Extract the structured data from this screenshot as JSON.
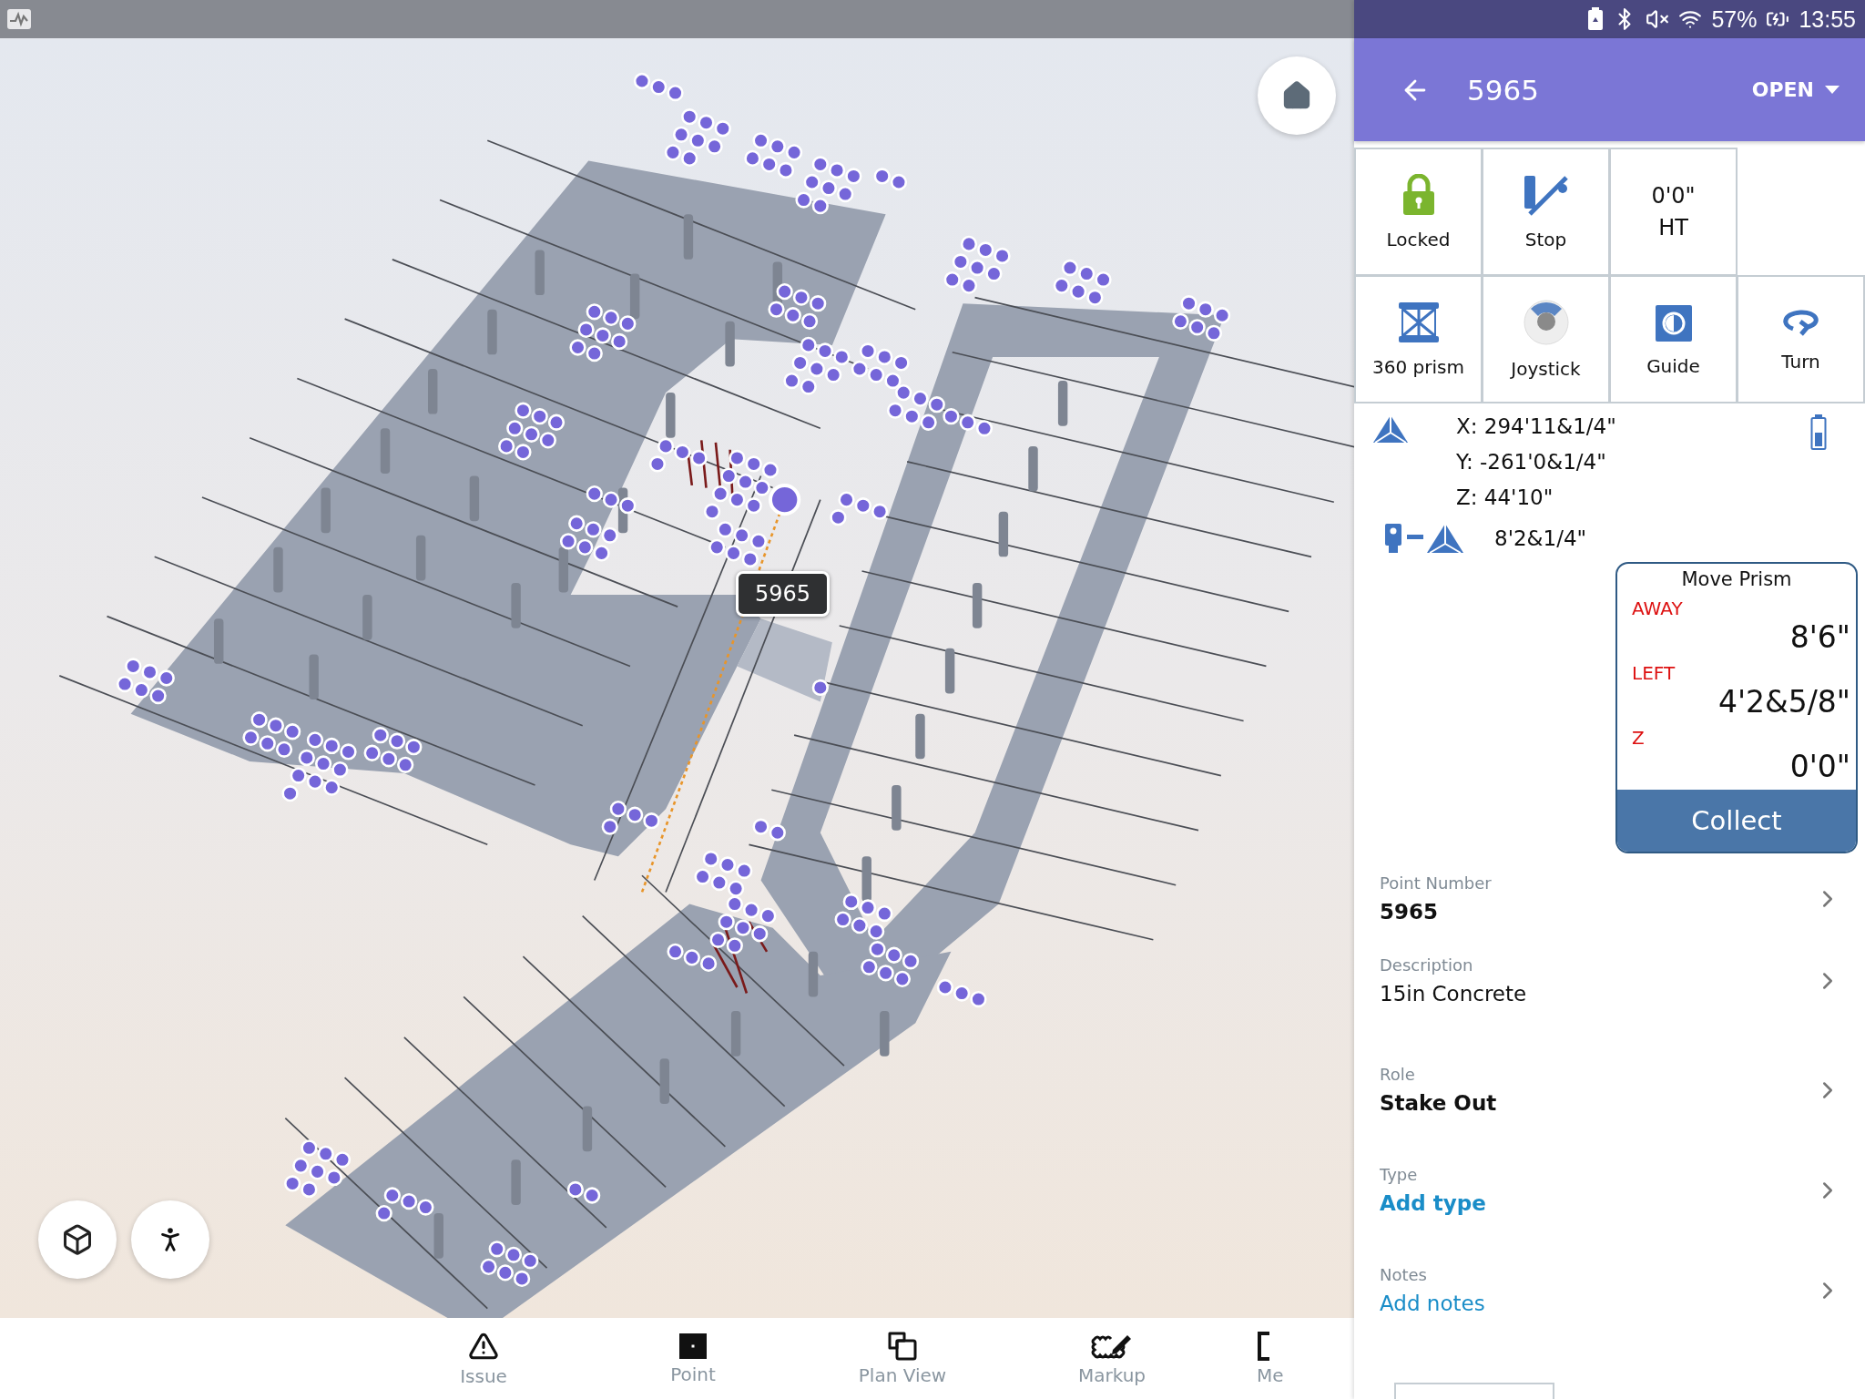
{
  "status_bar": {
    "battery": "57%",
    "time": "13:55"
  },
  "viewport": {
    "point_label": "5965"
  },
  "bottom_nav": [
    {
      "label": "Issue",
      "kind": "issue"
    },
    {
      "label": "Point",
      "kind": "point"
    },
    {
      "label": "Plan View",
      "kind": "plan"
    },
    {
      "label": "Markup",
      "kind": "markup"
    },
    {
      "label": "Me",
      "kind": "cut"
    }
  ],
  "panel": {
    "title": "5965",
    "status": "OPEN",
    "tiles": [
      {
        "kind": "lock",
        "label": "Locked"
      },
      {
        "kind": "stop",
        "label": "Stop"
      },
      {
        "kind": "value",
        "value": "0'0\"",
        "label": "HT"
      },
      {
        "kind": "empty"
      },
      {
        "kind": "prism",
        "label": "360 prism"
      },
      {
        "kind": "joystick",
        "label": "Joystick"
      },
      {
        "kind": "guide",
        "label": "Guide"
      },
      {
        "kind": "turn",
        "label": "Turn"
      }
    ],
    "coordinates": [
      "X: 294'11&1/4\"",
      "Y: -261'0&1/4\"",
      "Z: 44'10\""
    ],
    "distance": "8'2&1/4\"",
    "move_prism": {
      "title": "Move Prism",
      "rows": [
        {
          "direction": "AWAY",
          "value": "8'6\""
        },
        {
          "direction": "LEFT",
          "value": "4'2&5/8\""
        },
        {
          "direction": "Z",
          "value": "0'0\""
        }
      ],
      "action": "Collect"
    },
    "fields": [
      {
        "label": "Point Number",
        "value": "5965",
        "kind": "bold"
      },
      {
        "label": "Description",
        "value": "15in Concrete",
        "kind": "plain"
      },
      {
        "label": "Role",
        "value": "Stake Out",
        "kind": "bold"
      },
      {
        "label": "Type",
        "value": "Add type",
        "kind": "link-bold"
      },
      {
        "label": "Notes",
        "value": "Add notes",
        "kind": "link"
      }
    ]
  }
}
